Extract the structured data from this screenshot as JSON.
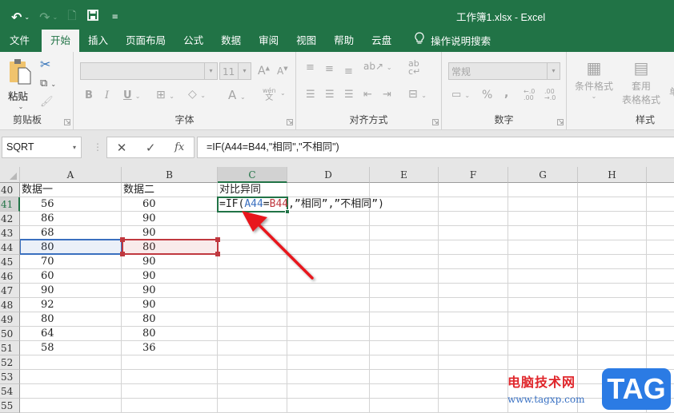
{
  "window": {
    "title": "工作簿1.xlsx  -  Excel",
    "accent_color": "#217346"
  },
  "quick_access": {
    "undo_icon": "undo-icon",
    "redo_icon": "redo-icon",
    "print_preview_icon": "print-preview-icon",
    "save_icon": "save-icon",
    "customize_icon": "customize-qat-icon"
  },
  "tabs": [
    {
      "label": "文件",
      "active": false
    },
    {
      "label": "开始",
      "active": true
    },
    {
      "label": "插入",
      "active": false
    },
    {
      "label": "页面布局",
      "active": false
    },
    {
      "label": "公式",
      "active": false
    },
    {
      "label": "数据",
      "active": false
    },
    {
      "label": "审阅",
      "active": false
    },
    {
      "label": "视图",
      "active": false
    },
    {
      "label": "帮助",
      "active": false
    },
    {
      "label": "云盘",
      "active": false
    }
  ],
  "tell_me": {
    "label": "操作说明搜索",
    "icon": "lightbulb-icon"
  },
  "ribbon": {
    "clipboard": {
      "label": "剪贴板",
      "paste_label": "粘贴",
      "cut_icon": "cut-icon",
      "copy_icon": "copy-icon",
      "format_painter_icon": "format-painter-icon"
    },
    "font": {
      "label": "字体",
      "font_name": "",
      "font_size": "11",
      "bold": "B",
      "italic": "I",
      "underline": "U",
      "grow": "A",
      "shrink": "A",
      "font_color": "A",
      "phonetic_top": "wén",
      "phonetic_bottom": "文"
    },
    "alignment": {
      "label": "对齐方式",
      "wrap_label": "ab"
    },
    "number": {
      "label": "数字",
      "format": "常规",
      "percent": "%",
      "comma": ",",
      "inc_decimal": "←.0 .00",
      "dec_decimal": ".00 →.0"
    },
    "styles": {
      "label": "样式",
      "conditional_format": "条件格式",
      "format_table_line1": "套用",
      "format_table_line2": "表格格式",
      "cell_styles_partial": "单"
    }
  },
  "formula_bar": {
    "name_box": "SQRT",
    "cancel": "✕",
    "enter": "✓",
    "fx": "fx",
    "formula": "=IF(A44=B44,\"相同\",\"不相同\")"
  },
  "columns": [
    "A",
    "B",
    "C",
    "D",
    "E",
    "F",
    "G",
    "H"
  ],
  "selected_column": "C",
  "rows": [
    {
      "n": "40",
      "A": "数据一",
      "B": "数据二",
      "C": "对比异同"
    },
    {
      "n": "41",
      "A": "56",
      "B": "60",
      "C": ""
    },
    {
      "n": "42",
      "A": "86",
      "B": "90",
      "C": ""
    },
    {
      "n": "43",
      "A": "68",
      "B": "90",
      "C": ""
    },
    {
      "n": "44",
      "A": "80",
      "B": "80",
      "C": ""
    },
    {
      "n": "45",
      "A": "70",
      "B": "90",
      "C": ""
    },
    {
      "n": "46",
      "A": "60",
      "B": "90",
      "C": ""
    },
    {
      "n": "47",
      "A": "90",
      "B": "90",
      "C": ""
    },
    {
      "n": "48",
      "A": "92",
      "B": "90",
      "C": ""
    },
    {
      "n": "49",
      "A": "80",
      "B": "80",
      "C": ""
    },
    {
      "n": "50",
      "A": "64",
      "B": "80",
      "C": ""
    },
    {
      "n": "51",
      "A": "58",
      "B": "36",
      "C": ""
    },
    {
      "n": "52",
      "A": "",
      "B": "",
      "C": ""
    },
    {
      "n": "53",
      "A": "",
      "B": "",
      "C": ""
    },
    {
      "n": "54",
      "A": "",
      "B": "",
      "C": ""
    },
    {
      "n": "55",
      "A": "",
      "B": "",
      "C": ""
    }
  ],
  "editing": {
    "cell": "C41",
    "parts": [
      "=IF(",
      "A44",
      "=",
      "B44",
      ",”相同”,”不相同”)"
    ],
    "ref_a_color": "#3a6fbf",
    "ref_b_color": "#c0383f"
  },
  "annotation": {
    "arrow_color": "#e8191f"
  },
  "watermark": {
    "site_name": "电脑技术网",
    "url": "www.tagxp.com",
    "badge": "TAG"
  }
}
